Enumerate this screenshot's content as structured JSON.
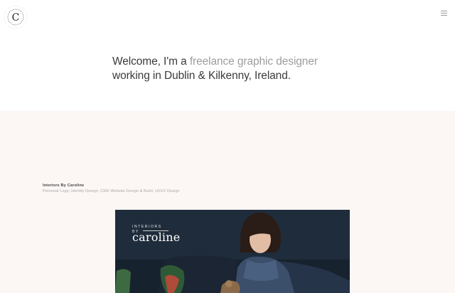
{
  "header": {
    "logo_icon": "circular-monogram-logo",
    "menu_icon": "hamburger-menu-icon"
  },
  "intro": {
    "part1": "Welcome, I'm a ",
    "highlight": "freelance graphic designer",
    "part2": "working in Dublin & Kilkenny, Ireland."
  },
  "project": {
    "title": "Interiors By Caroline",
    "tags": "Personal Logo, Identity Design, CMS Website Design & Build, UI/UX Design",
    "image": {
      "brand_small_line1": "INTERIORS",
      "brand_small_line2": "BY",
      "brand_big": "caroline"
    }
  },
  "colors": {
    "highlight_text": "#9d9d9d",
    "section_background": "#fcf6f5",
    "hero_background": "#1f2c3b"
  }
}
